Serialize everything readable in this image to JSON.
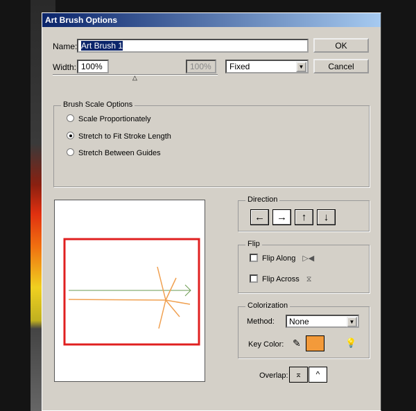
{
  "title": "Art Brush Options",
  "name": {
    "label": "Name:",
    "value": "Art Brush 1"
  },
  "width": {
    "label": "Width:",
    "value": "100%",
    "variation": "100%",
    "mode": "Fixed"
  },
  "buttons": {
    "ok": "OK",
    "cancel": "Cancel"
  },
  "scale": {
    "legend": "Brush Scale Options",
    "options": [
      "Scale Proportionately",
      "Stretch to Fit Stroke Length",
      "Stretch Between Guides"
    ],
    "selected": 1
  },
  "direction": {
    "legend": "Direction",
    "buttons": [
      "←",
      "→",
      "↑",
      "↓"
    ],
    "selected": 1
  },
  "flip": {
    "legend": "Flip",
    "along": "Flip Along",
    "across": "Flip Across"
  },
  "colorization": {
    "legend": "Colorization",
    "method_label": "Method:",
    "method": "None",
    "key_label": "Key Color:",
    "key_color": "#f39a3a"
  },
  "overlap": {
    "label": "Overlap:"
  }
}
